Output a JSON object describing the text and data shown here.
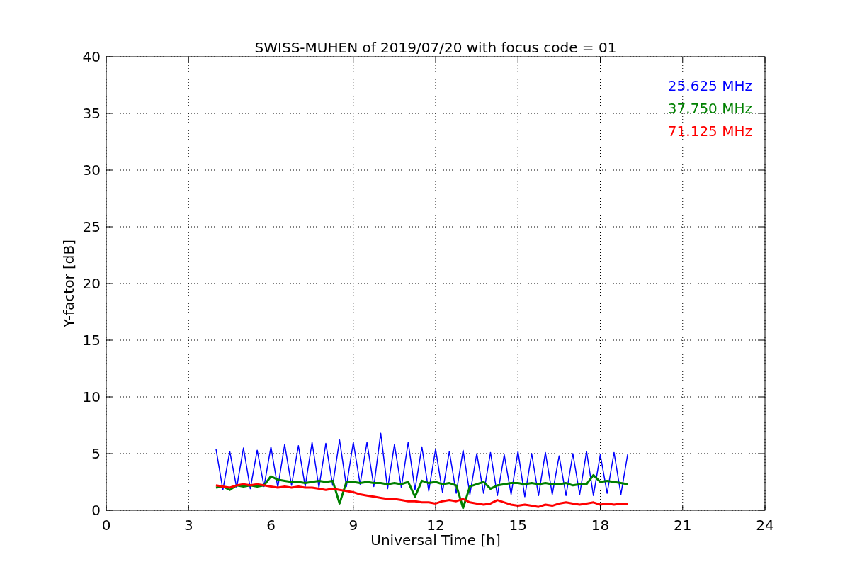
{
  "chart_data": {
    "type": "line",
    "title": "SWISS-MUHEN of 2019/07/20 with focus code = 01",
    "xlabel": "Universal Time [h]",
    "ylabel": "Y-factor [dB]",
    "x": [
      4,
      4.25,
      4.5,
      4.75,
      5,
      5.25,
      5.5,
      5.75,
      6,
      6.25,
      6.5,
      6.75,
      7,
      7.25,
      7.5,
      7.75,
      8,
      8.25,
      8.5,
      8.75,
      9,
      9.25,
      9.5,
      9.75,
      10,
      10.25,
      10.5,
      10.75,
      11,
      11.25,
      11.5,
      11.75,
      12,
      12.25,
      12.5,
      12.75,
      13,
      13.25,
      13.5,
      13.75,
      14,
      14.25,
      14.5,
      14.75,
      15,
      15.25,
      15.5,
      15.75,
      16,
      16.25,
      16.5,
      16.75,
      17,
      17.25,
      17.5,
      17.75,
      18,
      18.25,
      18.5,
      18.75,
      19
    ],
    "series": [
      {
        "name": "25.625 MHz",
        "color": "#0000ff",
        "values": [
          5.4,
          1.8,
          5.2,
          2.0,
          5.5,
          1.9,
          5.3,
          2.1,
          5.6,
          2.0,
          5.8,
          2.2,
          5.7,
          2.1,
          6.0,
          2.0,
          5.9,
          2.2,
          6.2,
          2.1,
          6.0,
          2.3,
          6.0,
          2.1,
          6.8,
          1.9,
          5.8,
          2.0,
          6.0,
          1.8,
          5.6,
          1.7,
          5.4,
          1.6,
          5.2,
          1.5,
          5.3,
          1.4,
          5.0,
          1.5,
          5.1,
          1.3,
          4.9,
          1.4,
          5.2,
          1.2,
          5.0,
          1.3,
          5.1,
          1.4,
          4.8,
          1.3,
          5.0,
          1.4,
          5.2,
          1.3,
          4.9,
          1.5,
          5.1,
          1.4,
          5.0
        ]
      },
      {
        "name": "37.750 MHz",
        "color": "#008000",
        "values": [
          2.0,
          2.1,
          1.8,
          2.2,
          2.1,
          2.2,
          2.1,
          2.2,
          3.0,
          2.7,
          2.6,
          2.5,
          2.5,
          2.4,
          2.5,
          2.6,
          2.5,
          2.6,
          0.6,
          2.5,
          2.5,
          2.4,
          2.5,
          2.4,
          2.4,
          2.3,
          2.4,
          2.3,
          2.5,
          1.2,
          2.6,
          2.4,
          2.5,
          2.3,
          2.4,
          2.2,
          0.2,
          2.1,
          2.3,
          2.5,
          1.9,
          2.2,
          2.3,
          2.4,
          2.4,
          2.3,
          2.4,
          2.3,
          2.4,
          2.3,
          2.3,
          2.4,
          2.2,
          2.3,
          2.3,
          3.1,
          2.5,
          2.6,
          2.5,
          2.4,
          2.3
        ]
      },
      {
        "name": "71.125 MHz",
        "color": "#ff0000",
        "values": [
          2.2,
          2.1,
          2.0,
          2.2,
          2.3,
          2.2,
          2.3,
          2.2,
          2.1,
          2.0,
          2.1,
          2.0,
          2.1,
          2.0,
          2.0,
          1.9,
          1.8,
          1.9,
          1.8,
          1.7,
          1.6,
          1.4,
          1.3,
          1.2,
          1.1,
          1.0,
          1.0,
          0.9,
          0.8,
          0.8,
          0.7,
          0.7,
          0.6,
          0.8,
          0.9,
          0.8,
          1.0,
          0.7,
          0.6,
          0.5,
          0.6,
          0.9,
          0.7,
          0.5,
          0.4,
          0.5,
          0.4,
          0.3,
          0.5,
          0.4,
          0.6,
          0.7,
          0.6,
          0.5,
          0.6,
          0.7,
          0.5,
          0.6,
          0.5,
          0.6,
          0.6
        ]
      }
    ],
    "grid": true,
    "xlim": [
      0,
      24
    ],
    "ylim": [
      0,
      40
    ],
    "xticks": [
      0,
      3,
      6,
      9,
      12,
      15,
      18,
      21,
      24
    ],
    "yticks": [
      0,
      5,
      10,
      15,
      20,
      25,
      30,
      35,
      40
    ]
  }
}
